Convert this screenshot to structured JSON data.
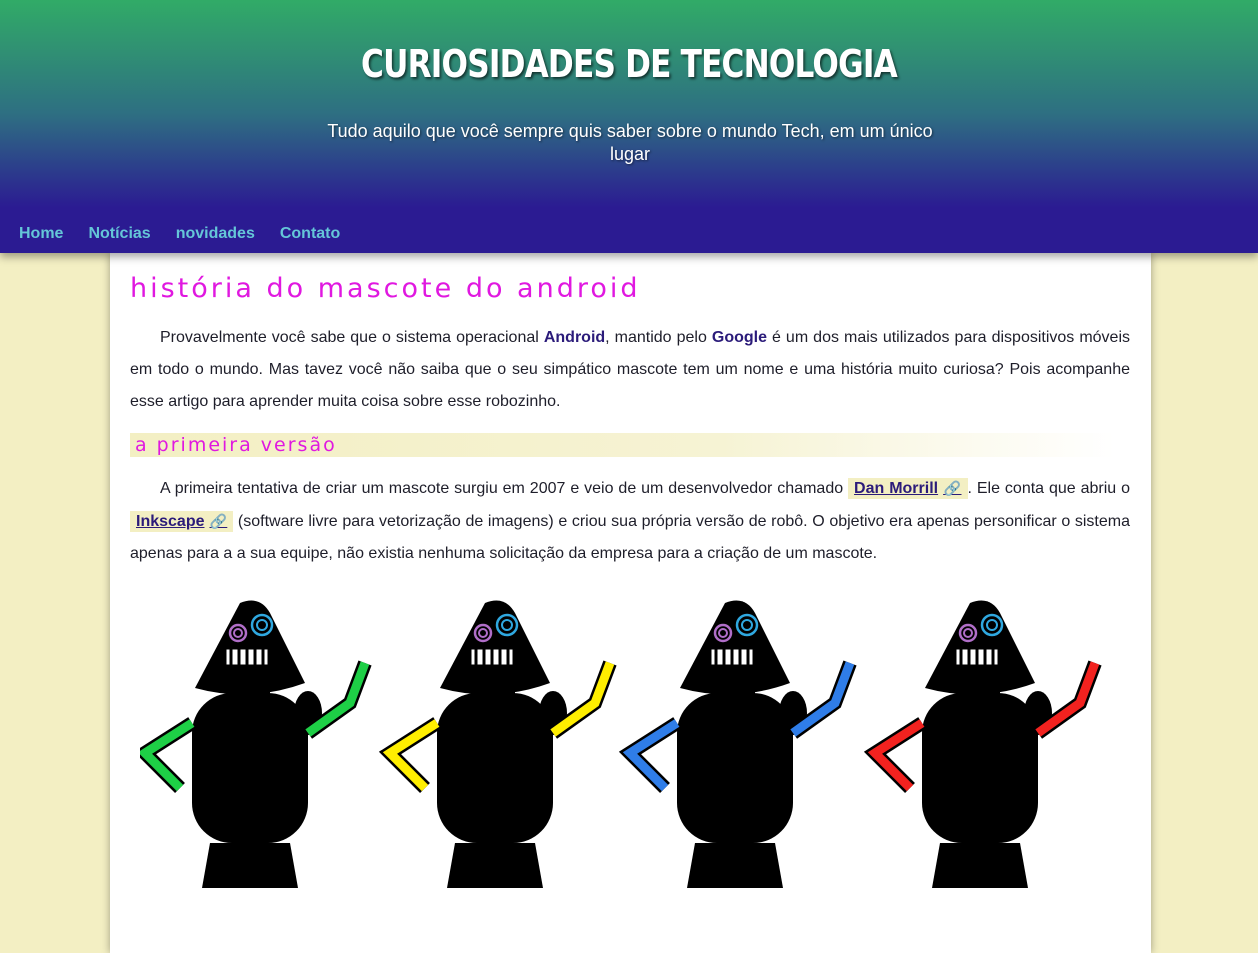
{
  "site": {
    "title": "CURIOSIDADES DE TECNOLOGIA",
    "tagline": "Tudo aquilo que você sempre quis saber sobre o mundo Tech, em um único lugar"
  },
  "nav": {
    "items": [
      {
        "label": "Home"
      },
      {
        "label": "Notícias"
      },
      {
        "label": "novidades"
      },
      {
        "label": "Contato"
      }
    ]
  },
  "article": {
    "title": "História do mascote do Android",
    "intro": {
      "t1": "Provavelmente você sabe que o sistema operacional ",
      "android": "Android",
      "t2": ", mantido pelo ",
      "google": "Google",
      "t3": " é um dos mais utilizados para dispositivos móveis em todo o mundo. Mas tavez você não saiba que o seu simpático mascote tem um nome e uma história muito curiosa? Pois acompanhe esse artigo para aprender muita coisa sobre esse robozinho."
    },
    "section1": {
      "title": "A primeira versão",
      "t1": "A primeira tentativa de criar um mascote surgiu em 2007 e veio de um desenvolvedor chamado ",
      "link1": "Dan Morrill",
      "t2": ". Ele conta que abriu o ",
      "link2": "Inkscape",
      "t3": " (software livre para vetorização de imagens) e criou sua própria versão de robô. O objetivo era apenas personificar o sistema apenas para a a sua equipe, não existia nenhuma solicitação da empresa para a criação de um mascote."
    },
    "image": {
      "robots": [
        {
          "color": "green",
          "fill": "#1ecf46",
          "dark": "#0ea83a"
        },
        {
          "color": "yellow",
          "fill": "#ffee00",
          "dark": "#e9d500"
        },
        {
          "color": "blue",
          "fill": "#2f7de8",
          "dark": "#1a5fd0"
        },
        {
          "color": "red",
          "fill": "#f2221f",
          "dark": "#cf1a17"
        }
      ]
    }
  },
  "icons": {
    "external_link": "🔗"
  }
}
